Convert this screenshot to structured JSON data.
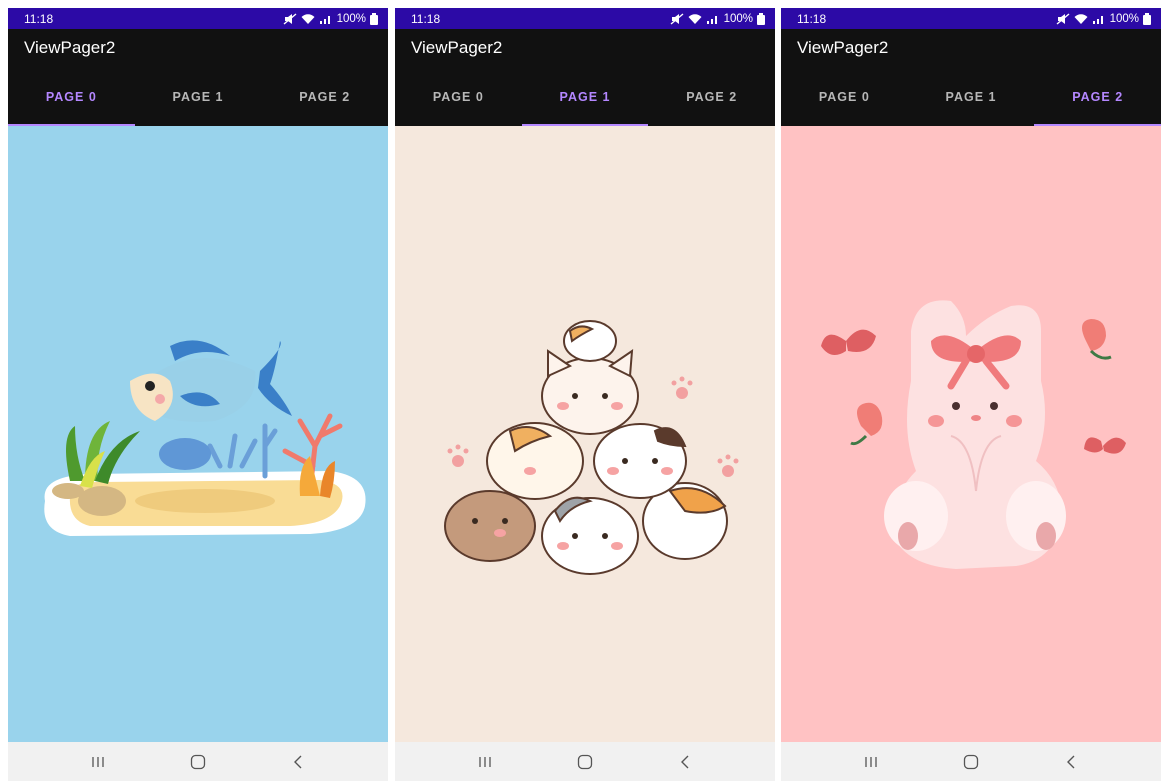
{
  "screens": [
    {
      "status": {
        "time": "11:18",
        "battery": "100%"
      },
      "title": "ViewPager2",
      "tabs": [
        {
          "label": "PAGE 0"
        },
        {
          "label": "PAGE 1"
        },
        {
          "label": "PAGE 2"
        }
      ],
      "active_tab": 0,
      "page_bg": "#99d3ec",
      "illustration": "fish-aquarium-illustration"
    },
    {
      "status": {
        "time": "11:18",
        "battery": "100%"
      },
      "title": "ViewPager2",
      "tabs": [
        {
          "label": "PAGE 0"
        },
        {
          "label": "PAGE 1"
        },
        {
          "label": "PAGE 2"
        }
      ],
      "active_tab": 1,
      "page_bg": "#f5e8dd",
      "illustration": "cat-pile-illustration"
    },
    {
      "status": {
        "time": "11:18",
        "battery": "100%"
      },
      "title": "ViewPager2",
      "tabs": [
        {
          "label": "PAGE 0"
        },
        {
          "label": "PAGE 1"
        },
        {
          "label": "PAGE 2"
        }
      ],
      "active_tab": 2,
      "page_bg": "#ffc2c3",
      "illustration": "bunny-with-bow-illustration"
    }
  ],
  "colors": {
    "status_bar": "#2c0aa6",
    "app_bar": "#111111",
    "tab_indicator": "#b487ff",
    "nav_bar": "#f1f1f1"
  },
  "nav_icons": [
    "recents-icon",
    "home-icon",
    "back-icon"
  ]
}
